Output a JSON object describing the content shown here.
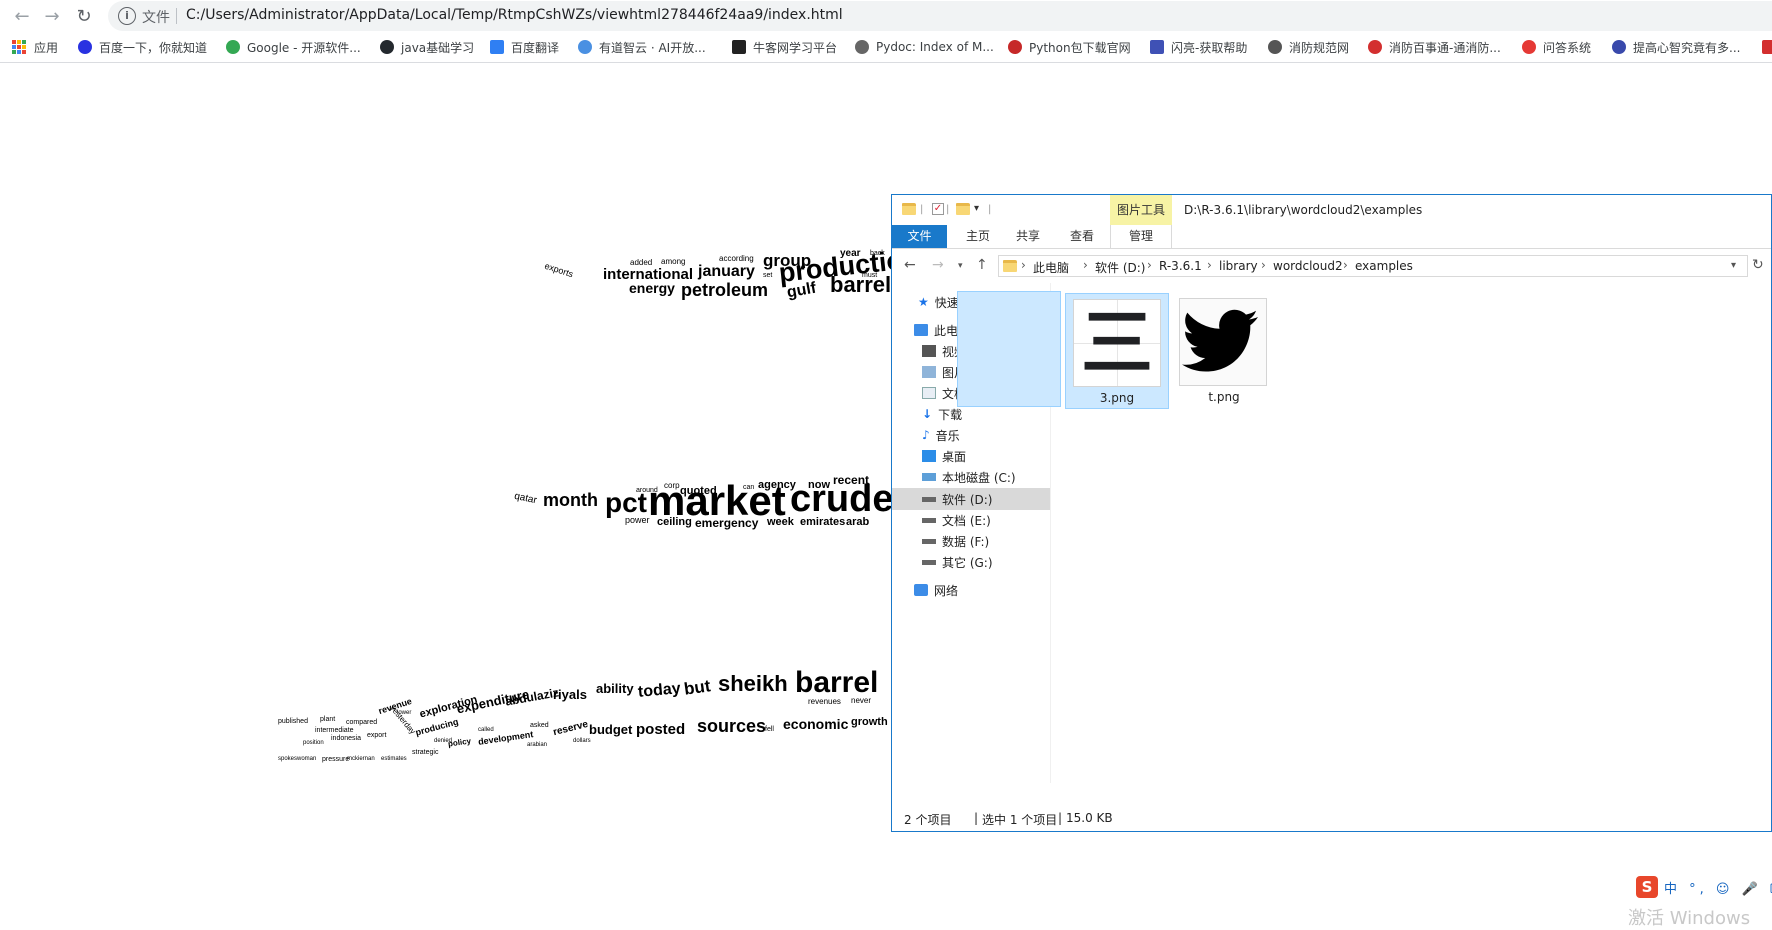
{
  "browser": {
    "address_scheme": "文件",
    "url": "C:/Users/Administrator/AppData/Local/Temp/RtmpCshWZs/viewhtml278446f24aa9/index.html"
  },
  "bookmarks": [
    {
      "label": "应用",
      "color": "#4285f4"
    },
    {
      "label": "百度一下，你就知道",
      "color": "#2932e1"
    },
    {
      "label": "Google - 开源软件...",
      "color": "#34a853"
    },
    {
      "label": "java基础学习",
      "color": "#24292e"
    },
    {
      "label": "百度翻译",
      "color": "#2f7ff3"
    },
    {
      "label": "有道智云 · AI开放...",
      "color": "#4a90e2"
    },
    {
      "label": "牛客网学习平台",
      "color": "#222222"
    },
    {
      "label": "Pydoc: Index of M...",
      "color": "#666666"
    },
    {
      "label": "Python包下载官网",
      "color": "#c62828"
    },
    {
      "label": "闪亮-获取帮助",
      "color": "#3f51b5"
    },
    {
      "label": "消防规范网",
      "color": "#555555"
    },
    {
      "label": "消防百事通-通消防...",
      "color": "#d32f2f"
    },
    {
      "label": "问答系统",
      "color": "#e53935"
    },
    {
      "label": "提高心智究竟有多...",
      "color": "#3949ab"
    }
  ],
  "wordcloud": {
    "group1": [
      "exports",
      "international",
      "january",
      "group",
      "production",
      "energy",
      "petroleum",
      "gulf",
      "barrel",
      "added",
      "among",
      "according",
      "year",
      "set",
      "must",
      "back"
    ],
    "group2": [
      "qatar",
      "month",
      "pct",
      "market",
      "crude",
      "quoted",
      "agency",
      "now",
      "recent",
      "power",
      "ceiling",
      "emergency",
      "week",
      "emirates",
      "arab",
      "corp",
      "can",
      "around"
    ],
    "group3": [
      "published",
      "plant",
      "compared",
      "revenue",
      "exploration",
      "expenditure",
      "abdulaziz",
      "riyals",
      "ability",
      "today",
      "but",
      "sheikh",
      "barrel",
      "revenues",
      "never",
      "producing",
      "intermediate",
      "indonesia",
      "export",
      "yesterday",
      "policy",
      "development",
      "budget",
      "posted",
      "sources",
      "economic",
      "growth",
      "reserve",
      "asked",
      "strategic",
      "pressure",
      "mckiernan",
      "estimates",
      "denied",
      "called",
      "dollars",
      "arabian",
      "position",
      "fell",
      "lower",
      "spokeswoman"
    ]
  },
  "explorer": {
    "title_path": "D:\\R-3.6.1\\library\\wordcloud2\\examples",
    "context_tab": "图片工具",
    "ribbon_tabs": [
      "文件",
      "主页",
      "共享",
      "查看",
      "管理"
    ],
    "breadcrumbs": [
      "此电脑",
      "软件 (D:)",
      "R-3.6.1",
      "library",
      "wordcloud2",
      "examples"
    ],
    "nav": {
      "quick_access": "快速访问",
      "this_pc": "此电脑",
      "items": [
        "视频",
        "图片",
        "文档",
        "下载",
        "音乐",
        "桌面",
        "本地磁盘 (C:)",
        "软件 (D:)",
        "文档 (E:)",
        "数据 (F:)",
        "其它 (G:)"
      ],
      "network": "网络",
      "selected": "软件 (D:)"
    },
    "files": [
      {
        "name": "3.png",
        "glyph": "三",
        "selected": true
      },
      {
        "name": "t.png",
        "icon": "twitter-bird-icon",
        "selected": false
      }
    ],
    "status": {
      "count": "2 个项目",
      "selected": "选中 1 个项目",
      "size": "15.0 KB"
    }
  },
  "tray": {
    "ime_logo": "S",
    "ime_text": "中 °, ☺ 🎤 ⌨",
    "watermark": "激活 Windows"
  }
}
